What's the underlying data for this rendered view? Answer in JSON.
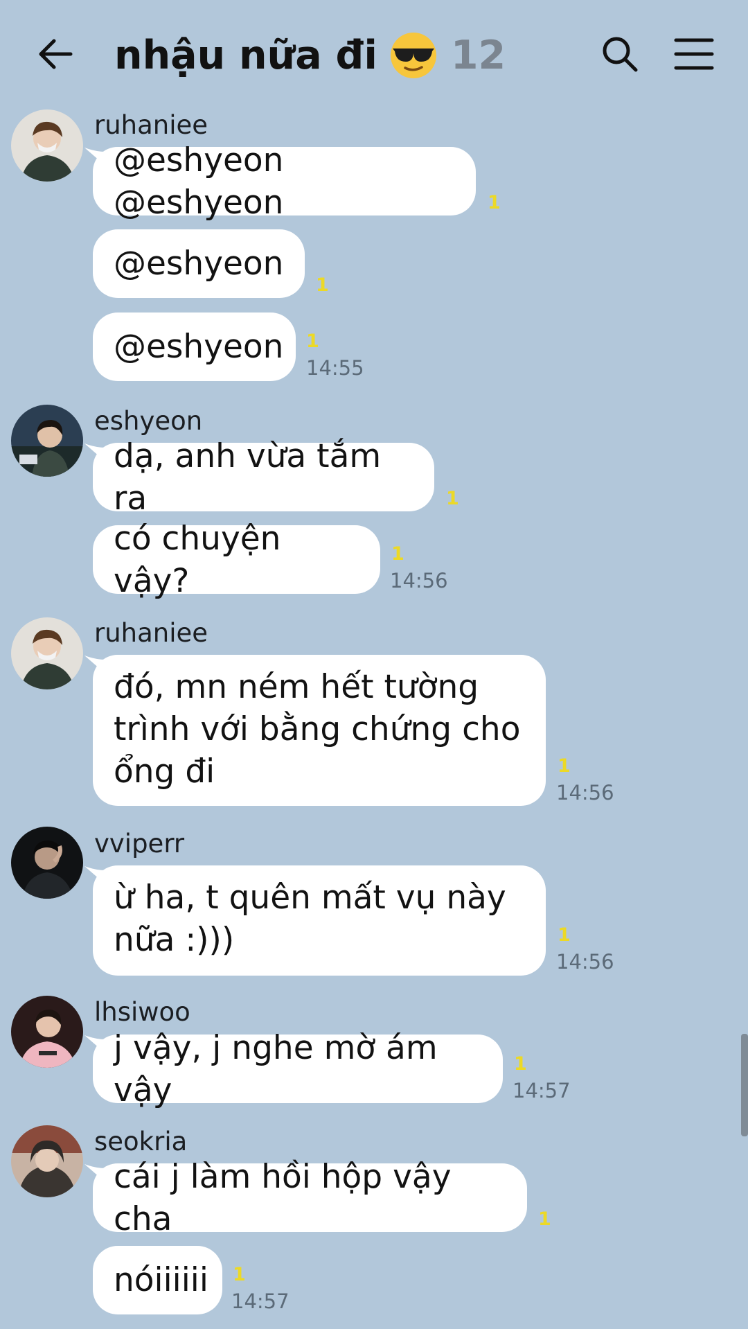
{
  "header": {
    "title": "nhậu nữa đi",
    "title_icon": "sunglasses-emoji-icon",
    "member_count": "12",
    "back_icon": "back-arrow-icon",
    "search_icon": "search-icon",
    "menu_icon": "menu-icon"
  },
  "colors": {
    "background": "#b2c7da",
    "bubble": "#ffffff",
    "unread": "#ecd926",
    "time": "#5b6a78"
  },
  "messages": [
    {
      "sender": "ruhaniee",
      "bubbles": [
        {
          "text": "@eshyeon @eshyeon",
          "unread": "1"
        },
        {
          "text": "@eshyeon",
          "unread": "1"
        },
        {
          "text": "@eshyeon",
          "unread": "1",
          "time": "14:55"
        }
      ]
    },
    {
      "sender": "eshyeon",
      "bubbles": [
        {
          "text": "dạ, anh vừa tắm ra",
          "unread": "1"
        },
        {
          "text": "có chuyện vậy?",
          "unread": "1",
          "time": "14:56"
        }
      ]
    },
    {
      "sender": "ruhaniee",
      "bubbles": [
        {
          "lines": [
            "đó, mn ném hết tường",
            "trình với bằng chứng cho",
            "ổng đi"
          ],
          "unread": "1",
          "time": "14:56"
        }
      ]
    },
    {
      "sender": "vviperr",
      "bubbles": [
        {
          "lines": [
            "ừ ha, t quên mất vụ này",
            "nữa :)))"
          ],
          "unread": "1",
          "time": "14:56"
        }
      ]
    },
    {
      "sender": "lhsiwoo",
      "bubbles": [
        {
          "text": "j vậy, j nghe mờ ám vậy",
          "unread": "1",
          "time": "14:57"
        }
      ]
    },
    {
      "sender": "seokria",
      "bubbles": [
        {
          "text": "cái j làm hồi hộp vậy cha",
          "unread": "1"
        },
        {
          "text": "nóiiiiii",
          "unread": "1",
          "time": "14:57"
        }
      ]
    }
  ]
}
